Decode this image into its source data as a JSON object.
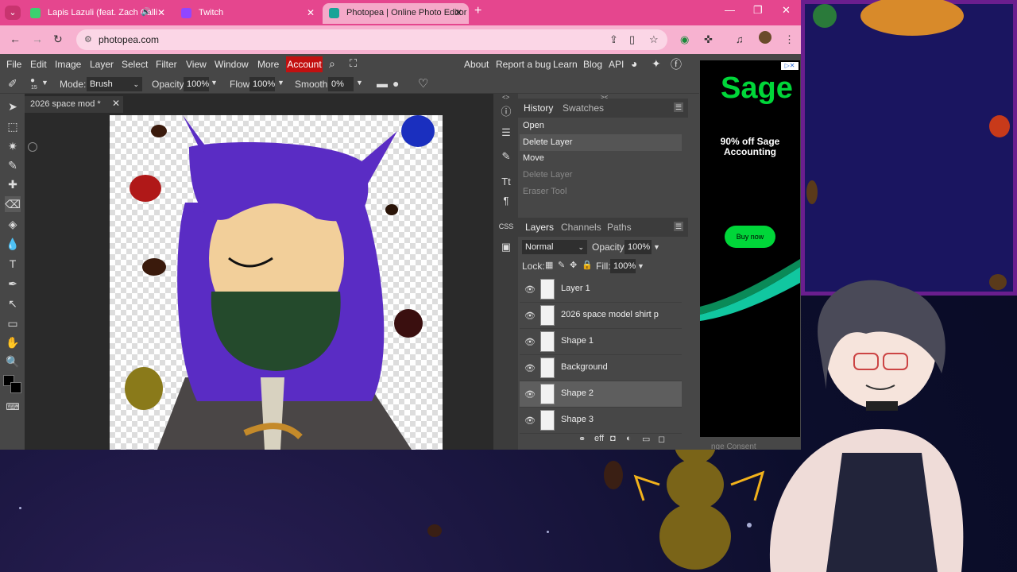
{
  "browser": {
    "tabs": [
      {
        "label": "Lapis Lazuli (feat. Zach Calli",
        "active": false
      },
      {
        "label": "Twitch",
        "active": false
      },
      {
        "label": "Photopea | Online Photo Editor",
        "active": true
      }
    ],
    "url": "photopea.com"
  },
  "menubar": {
    "items": [
      "File",
      "Edit",
      "Image",
      "Layer",
      "Select",
      "Filter",
      "View",
      "Window",
      "More"
    ],
    "account": "Account",
    "right_items": [
      "About",
      "Report a bug",
      "Learn",
      "Blog",
      "API"
    ]
  },
  "tool_options": {
    "mode_label": "Mode:",
    "mode_value": "Brush",
    "opacity_label": "Opacity:",
    "opacity_value": "100%",
    "flow_label": "Flow:",
    "flow_value": "100%",
    "smooth_label": "Smooth:",
    "smooth_value": "0%",
    "brush_size": "15"
  },
  "document": {
    "tab_title": "2026 space mod",
    "modified_marker": "*"
  },
  "panel_icons": {
    "text_tool": "Tt",
    "paragraph": "¶",
    "css": "CSS"
  },
  "history": {
    "tabs": [
      "History",
      "Swatches"
    ],
    "items": [
      {
        "label": "Open",
        "state": "normal"
      },
      {
        "label": "Delete Layer",
        "state": "selected"
      },
      {
        "label": "Move",
        "state": "normal"
      },
      {
        "label": "Delete Layer",
        "state": "dim"
      },
      {
        "label": "Eraser Tool",
        "state": "dim"
      }
    ]
  },
  "layers": {
    "tabs": [
      "Layers",
      "Channels",
      "Paths"
    ],
    "blend_mode": "Normal",
    "opacity_label": "Opacity:",
    "opacity_value": "100%",
    "lock_label": "Lock:",
    "fill_label": "Fill:",
    "fill_value": "100%",
    "items": [
      {
        "name": "Layer 1",
        "selected": false
      },
      {
        "name": "2026 space model shirt p",
        "selected": false
      },
      {
        "name": "Shape 1",
        "selected": false
      },
      {
        "name": "Background",
        "selected": false
      },
      {
        "name": "Shape 2",
        "selected": true
      },
      {
        "name": "Shape 3",
        "selected": false
      }
    ],
    "footer_fx": "eff"
  },
  "ad": {
    "logo": "Sage",
    "headline": "90% off Sage Accounting",
    "cta": "Buy now",
    "consent": "nge Consent"
  },
  "colors": {
    "tabbar": "#e5468e",
    "addrbar": "#f7b2d0",
    "account": "#c21010",
    "hair": "#5a2cc4",
    "ad_green": "#00d639"
  }
}
